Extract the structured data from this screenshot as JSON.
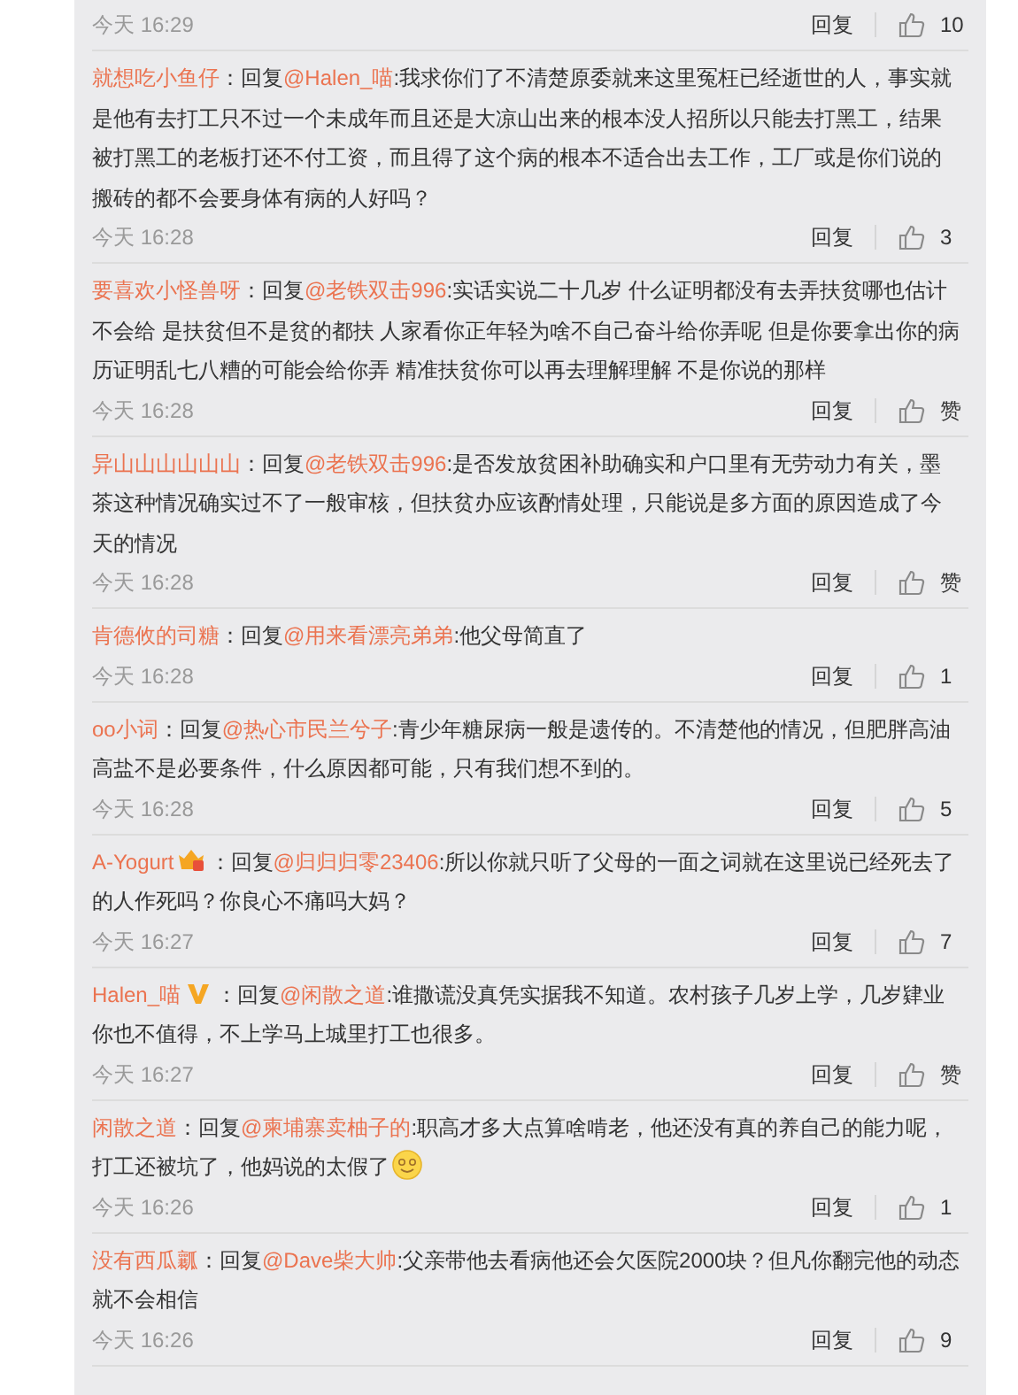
{
  "top_footer": {
    "time": "今天 16:29",
    "reply": "回复",
    "likes": "10"
  },
  "comments": [
    {
      "kind": "plain",
      "user": "就想吃小鱼仔",
      "sep": "：",
      "reply_word": "回复",
      "mention": "@Halen_喵",
      "text": ":我求你们了不清楚原委就来这里冤枉已经逝世的人，事实就是他有去打工只不过一个未成年而且还是大凉山出来的根本没人招所以只能去打黑工，结果被打黑工的老板打还不付工资，而且得了这个病的根本不适合出去工作，工厂或是你们说的搬砖的都不会要身体有病的人好吗？",
      "time": "今天 16:28",
      "reply": "回复",
      "likes": "3"
    },
    {
      "kind": "plain",
      "user": "要喜欢小怪兽呀",
      "sep": "：",
      "reply_word": "回复",
      "mention": "@老铁双击996",
      "text": ":实话实说二十几岁  什么证明都没有去弄扶贫哪也估计不会给  是扶贫但不是贫的都扶   人家看你正年轻为啥不自己奋斗给你弄呢  但是你要拿出你的病历证明乱七八糟的可能会给你弄  精准扶贫你可以再去理解理解  不是你说的那样",
      "time": "今天 16:28",
      "reply": "回复",
      "likes": "赞"
    },
    {
      "kind": "plain",
      "user": "异山山山山山山",
      "sep": "：",
      "reply_word": "回复",
      "mention": "@老铁双击996",
      "text": ":是否发放贫困补助确实和户口里有无劳动力有关，墨茶这种情况确实过不了一般审核，但扶贫办应该酌情处理，只能说是多方面的原因造成了今天的情况",
      "time": "今天 16:28",
      "reply": "回复",
      "likes": "赞"
    },
    {
      "kind": "plain",
      "user": "肯德攸的司糖",
      "sep": "：",
      "reply_word": "回复",
      "mention": "@用来看漂亮弟弟",
      "text": ":他父母简直了",
      "time": "今天 16:28",
      "reply": "回复",
      "likes": "1"
    },
    {
      "kind": "plain",
      "user": "oo小词",
      "sep": "：",
      "reply_word": "回复",
      "mention": "@热心市民兰兮子",
      "text": ":青少年糖尿病一般是遗传的。不清楚他的情况，但肥胖高油高盐不是必要条件，什么原因都可能，只有我们想不到的。",
      "time": "今天 16:28",
      "reply": "回复",
      "likes": "5"
    },
    {
      "kind": "member",
      "user": "A-Yogurt",
      "sep": "：",
      "reply_word": "回复",
      "mention": "@归归归零23406",
      "text": ":所以你就只听了父母的一面之词就在这里说已经死去了的人作死吗？你良心不痛吗大妈？",
      "time": "今天 16:27",
      "reply": "回复",
      "likes": "7"
    },
    {
      "kind": "verified",
      "user": "Halen_喵",
      "sep": "：",
      "reply_word": "回复",
      "mention": "@闲散之道",
      "text": ":谁撒谎没真凭实据我不知道。农村孩子几岁上学，几岁肄业你也不值得，不上学马上城里打工也很多。",
      "time": "今天 16:27",
      "reply": "回复",
      "likes": "赞"
    },
    {
      "kind": "plain",
      "user": "闲散之道",
      "sep": "：",
      "reply_word": "回复",
      "mention": "@柬埔寨卖柚子的",
      "text": ":职高才多大点算啥啃老，他还没有真的养自己的能力呢，打工还被坑了，他妈说的太假了",
      "emoji": true,
      "time": "今天 16:26",
      "reply": "回复",
      "likes": "1"
    },
    {
      "kind": "plain",
      "user": "没有西瓜瓤",
      "sep": "：",
      "reply_word": "回复",
      "mention": "@Dave柴大帅",
      "text": ":父亲带他去看病他还会欠医院2000块？但凡你翻完他的动态就不会相信",
      "time": "今天 16:26",
      "reply": "回复",
      "likes": "9"
    }
  ]
}
